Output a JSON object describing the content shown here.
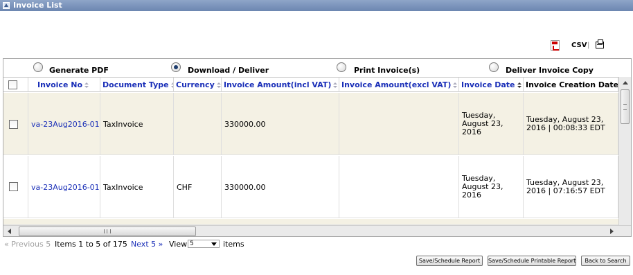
{
  "panel": {
    "title": "Invoice List"
  },
  "export": {
    "csv_label": "CSV",
    "separator": "|"
  },
  "actions": [
    {
      "label": "Generate PDF",
      "selected": false
    },
    {
      "label": "Download / Deliver",
      "selected": true
    },
    {
      "label": "Print Invoice(s)",
      "selected": false
    },
    {
      "label": "Deliver Invoice Copy",
      "selected": false
    }
  ],
  "table": {
    "columns": [
      {
        "label": "Invoice No",
        "sortable": true
      },
      {
        "label": "Document Type",
        "sortable": true
      },
      {
        "label": "Currency",
        "sortable": true
      },
      {
        "label": "Invoice Amount(incl VAT)",
        "sortable": true
      },
      {
        "label": "Invoice Amount(excl VAT)",
        "sortable": true
      },
      {
        "label": "Invoice Date",
        "sortable": true,
        "sorted": "desc"
      },
      {
        "label": "Invoice Creation Date",
        "sortable": false
      }
    ],
    "rows": [
      {
        "invoice_no": "va-23Aug2016-01",
        "document_type": "TaxInvoice",
        "currency": "",
        "amount_incl_vat": "330000.00",
        "amount_excl_vat": "",
        "invoice_date": "Tuesday, August 23, 2016",
        "creation_date": "Tuesday, August 23, 2016 | 00:08:33 EDT"
      },
      {
        "invoice_no": "va-23Aug2016-01",
        "document_type": "TaxInvoice",
        "currency": "CHF",
        "amount_incl_vat": "330000.00",
        "amount_excl_vat": "",
        "invoice_date": "Tuesday, August 23, 2016",
        "creation_date": "Tuesday, August 23, 2016 | 07:16:57 EDT"
      }
    ]
  },
  "pager": {
    "prev_label": "« Previous 5",
    "count_label": "Items 1 to 5 of 175",
    "next_label": "Next 5 »",
    "view_label": "View",
    "page_size": "5",
    "items_label": "items"
  },
  "buttons": {
    "save_report": "Save/Schedule Report",
    "save_printable_report": "Save/Schedule Printable Report",
    "back_to_search": "Back to Search"
  },
  "colors": {
    "link": "#1a2fb8",
    "titlebar": "#7891bb",
    "row_highlight": "#f4f1e4"
  }
}
